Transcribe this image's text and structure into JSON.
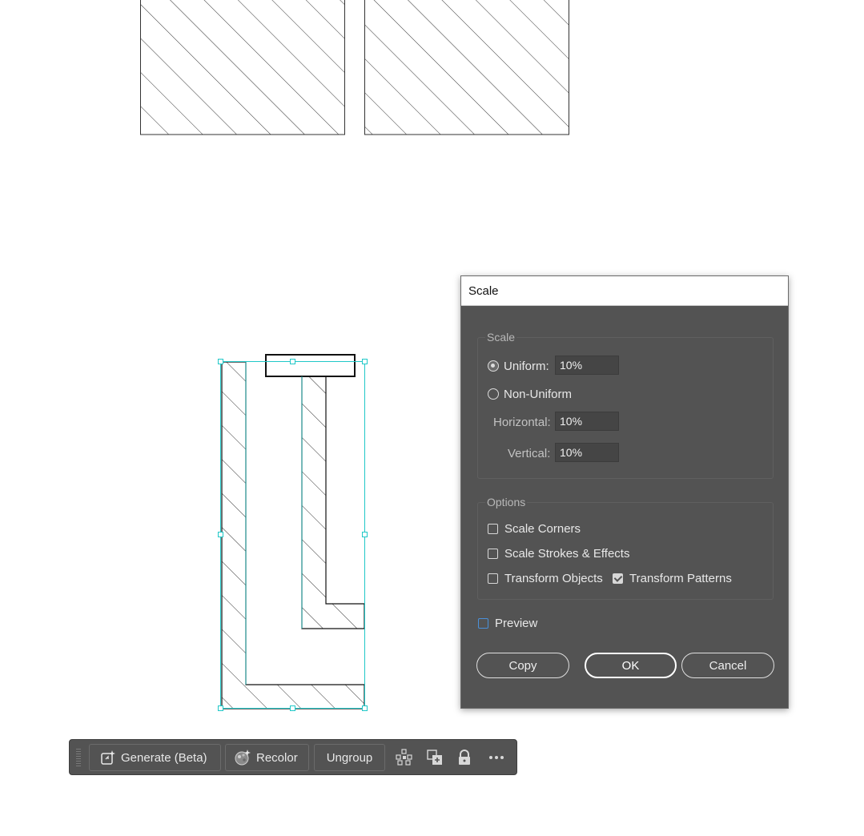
{
  "dialog": {
    "title": "Scale",
    "scale_group": {
      "legend": "Scale",
      "uniform_label": "Uniform:",
      "uniform_value": "10%",
      "uniform_selected": true,
      "non_uniform_label": "Non-Uniform",
      "horizontal_label": "Horizontal:",
      "horizontal_value": "10%",
      "vertical_label": "Vertical:",
      "vertical_value": "10%"
    },
    "options_group": {
      "legend": "Options",
      "scale_corners_label": "Scale Corners",
      "scale_corners_checked": false,
      "scale_strokes_label": "Scale Strokes & Effects",
      "scale_strokes_checked": false,
      "transform_objects_label": "Transform Objects",
      "transform_objects_checked": false,
      "transform_patterns_label": "Transform Patterns",
      "transform_patterns_checked": true
    },
    "preview_label": "Preview",
    "preview_checked": false,
    "buttons": {
      "copy": "Copy",
      "ok": "OK",
      "cancel": "Cancel"
    }
  },
  "contextual_toolbar": {
    "generate_label": "Generate (Beta)",
    "recolor_label": "Recolor",
    "ungroup_label": "Ungroup",
    "icons": [
      "generate-icon",
      "recolor-icon",
      "isolate-icon",
      "arrange-icon",
      "lock-icon",
      "more-icon"
    ]
  },
  "colors": {
    "dialog_bg": "#535353",
    "selection": "#20c8c8",
    "hatch": "#333333"
  }
}
